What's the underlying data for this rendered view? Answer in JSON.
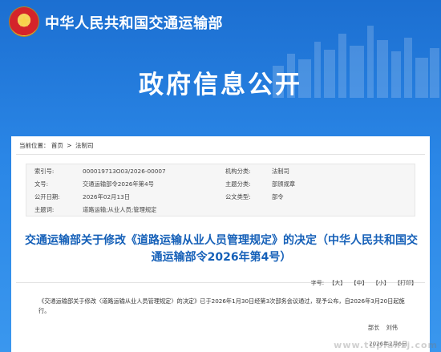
{
  "header": {
    "site_title": "中华人民共和国交通运输部"
  },
  "banner": {
    "title": "政府信息公开"
  },
  "breadcrumb": {
    "prefix": "当前位置：",
    "items": [
      "首页",
      "法制司"
    ],
    "separator": ">"
  },
  "meta": {
    "rows": [
      {
        "k1": "索引号:",
        "v1": "000019713O03/2026-00007",
        "k2": "机构分类:",
        "v2": "法制司"
      },
      {
        "k1": "文号:",
        "v1": "交通运输部令2026年第4号",
        "k2": "主题分类:",
        "v2": "部颁规章"
      },
      {
        "k1": "公开日期:",
        "v1": "2026年02月13日",
        "k2": "公文类型:",
        "v2": "部令"
      },
      {
        "k1": "主题词:",
        "v1": "道路运输;从业人员;管理规定",
        "k2": "",
        "v2": ""
      }
    ]
  },
  "document": {
    "title": "交通运输部关于修改《道路运输从业人员管理规定》的决定（中华人民共和国交通运输部令2026年第4号）",
    "font_tools": {
      "label": "字号:",
      "large": "【大】",
      "medium": "【中】",
      "small": "【小】",
      "print": "【打印】"
    },
    "body": "《交通运输部关于修改〈道路运输从业人员管理规定〉的决定》已于2026年1月30日经第3次部务会议通过，现予公布，自2026年3月20日起施行。",
    "signer_title": "部长",
    "signer_name": "刘伟",
    "date": "2026年2月6日"
  },
  "watermark": "www.tupianzj.com",
  "colors": {
    "banner_blue": "#2a86e6",
    "title_blue": "#1560b8"
  }
}
